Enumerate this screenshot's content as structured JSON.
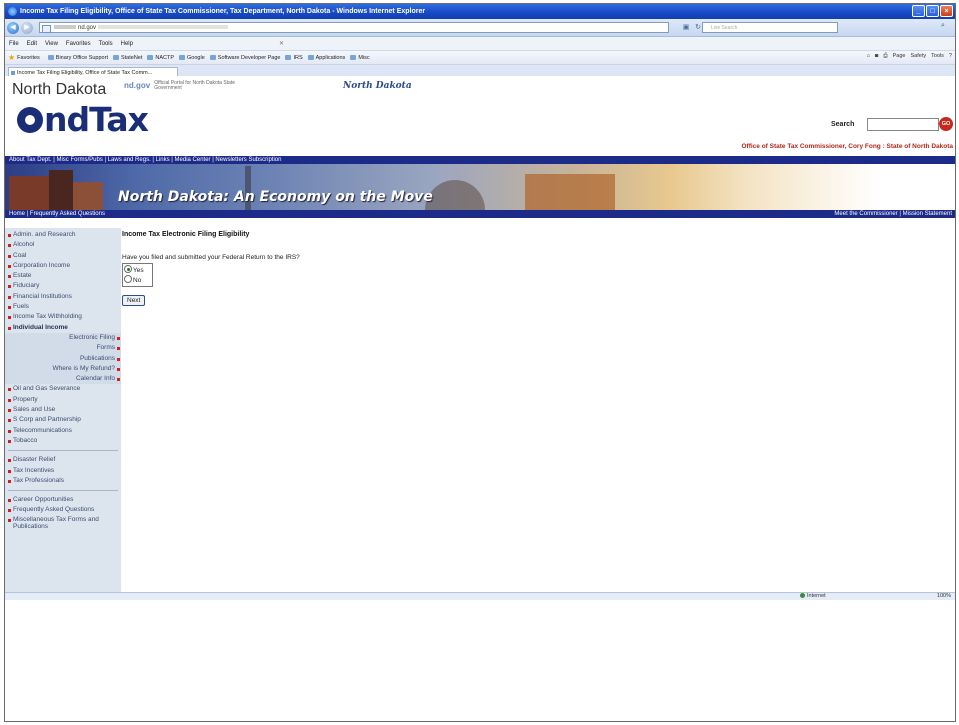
{
  "window": {
    "title": "Income Tax Filing Eligibility, Office of State Tax Commissioner, Tax Department, North Dakota - Windows Internet Explorer",
    "minimize": "_",
    "maximize": "□",
    "close": "×"
  },
  "address": {
    "visible_text": "nd.gov",
    "search_placeholder": "Live Search"
  },
  "menu": [
    "File",
    "Edit",
    "View",
    "Favorites",
    "Tools",
    "Help"
  ],
  "favorites": {
    "label": "Favorites",
    "items": [
      "Binary Office Support",
      "StateNet",
      "NACTP",
      "Google",
      "Software Developer Page",
      "IRS",
      "Applications",
      "Misc"
    ]
  },
  "command_bar": [
    "Page",
    "Safety",
    "Tools"
  ],
  "tab": {
    "title": "Income Tax Filing Eligibility, Office of State Tax Comm..."
  },
  "header": {
    "state_name": "North Dakota",
    "portal_brand": "nd.gov",
    "portal_tag": "Official Portal for North Dakota State Government",
    "script_logo": "North Dakota",
    "logo_text": "ndTax",
    "search_label": "Search",
    "go_label": "GO",
    "office_line": "Office of State Tax Commissioner, Cory Fong : State of North Dakota"
  },
  "top_nav": "About Tax Dept. | Misc Forms/Pubs | Laws and Regs. | Links | Media Center | Newsletters Subscription",
  "banner": {
    "slogan": "North Dakota: An Economy on the Move"
  },
  "sub_nav": {
    "left": "Home | Frequently Asked Questions",
    "right": "Meet the Commissioner | Mission Statement"
  },
  "sidebar": {
    "group1": [
      "Admin. and Research",
      "Alcohol",
      "Coal",
      "Corporation Income",
      "Estate",
      "Fiduciary",
      "Financial Institutions",
      "Fuels",
      "Income Tax Withholding"
    ],
    "active": "Individual Income",
    "subitems": [
      "Electronic Filing",
      "Forms",
      "Publications",
      "Where is My Refund?",
      "Calendar Info"
    ],
    "group2": [
      "Oil and Gas Severance",
      "Property",
      "Sales and Use",
      "S Corp and Partnership",
      "Telecommunications",
      "Tobacco"
    ],
    "group3": [
      "Disaster Relief",
      "Tax Incentives",
      "Tax Professionals"
    ],
    "group4": [
      "Career Opportunities",
      "Frequently Asked Questions",
      "Miscellaneous Tax Forms and Publications"
    ]
  },
  "main": {
    "heading": "Income Tax Electronic Filing Eligibility",
    "question": "Have you filed and submitted your Federal Return to the IRS?",
    "options": [
      "Yes",
      "No"
    ],
    "selected": "Yes",
    "next_label": "Next"
  },
  "status": {
    "zone": "Internet",
    "zoom": "100%"
  }
}
